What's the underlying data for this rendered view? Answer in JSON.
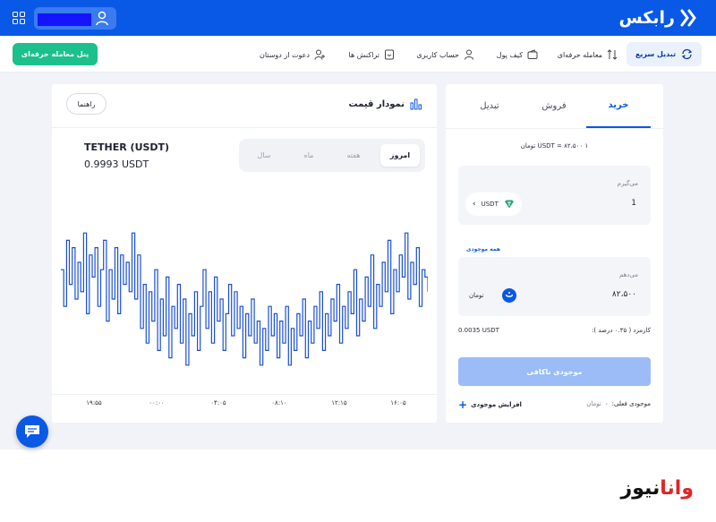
{
  "header": {
    "logo_text": "رابکس",
    "brand_color": "#0a58e6"
  },
  "nav": {
    "quick_swap": "تبدیل سریع",
    "pro_trade": "معامله حرفه‌ای",
    "wallet": "کیف پول",
    "account": "حساب کاربری",
    "transactions": "تراکنش ها",
    "invite": "دعوت از دوستان",
    "pro_panel_button": "پنل معامله حرفه‌ای"
  },
  "chart_panel": {
    "title": "نمودار قیمت",
    "guide_button": "راهنما",
    "coin_name": "TETHER (USDT)",
    "coin_price": "0.9993 USDT",
    "periods": [
      "امروز",
      "هفته",
      "ماه",
      "سال"
    ],
    "active_period": "امروز"
  },
  "chart_data": {
    "type": "line",
    "title": "",
    "xlabel": "",
    "ylabel": "",
    "x_ticks": [
      "۱۹:۵۵",
      "۰۰:۰۰",
      "۰۴:۰۵",
      "۰۸:۱۰",
      "۱۲:۱۵",
      "۱۶:۰۵"
    ],
    "line_color": "#1a4fd8",
    "ylim": [
      0,
      100
    ],
    "values": [
      70,
      45,
      90,
      60,
      85,
      50,
      75,
      55,
      95,
      40,
      80,
      65,
      85,
      45,
      70,
      90,
      35,
      70,
      50,
      85,
      40,
      80,
      60,
      75,
      55,
      95,
      50,
      80,
      30,
      60,
      20,
      55,
      35,
      70,
      15,
      50,
      25,
      65,
      10,
      45,
      30,
      60,
      20,
      50,
      5,
      40,
      25,
      55,
      15,
      45,
      70,
      30,
      55,
      20,
      65,
      35,
      50,
      15,
      40,
      60,
      25,
      55,
      30,
      45,
      10,
      40,
      25,
      50,
      20,
      35,
      5,
      30,
      15,
      45,
      25,
      40,
      10,
      35,
      20,
      45,
      5,
      30,
      15,
      40,
      25,
      50,
      10,
      35,
      20,
      45,
      30,
      55,
      15,
      40,
      25,
      50,
      35,
      60,
      20,
      45,
      30,
      55,
      40,
      70,
      25,
      50,
      35,
      65,
      45,
      80,
      30,
      60,
      45,
      75,
      55,
      90,
      40,
      70,
      55,
      80,
      65,
      95,
      50,
      75,
      60,
      85,
      45,
      70,
      65,
      55
    ]
  },
  "trade_panel": {
    "tabs": [
      "خرید",
      "فروش",
      "تبدیل"
    ],
    "active_tab": "خرید",
    "rate": "۱ USDT = ۸۲،۵۰۰ تومان",
    "receive_label": "می‌گیرم",
    "receive_value": "1",
    "receive_currency": "USDT",
    "all_balance": "همه موجودی",
    "pay_label": "می‌دهم",
    "pay_value": "۸۲،۵۰۰",
    "pay_currency": "تومان",
    "fee_label": "کارمزد ( ۰.۳۵ درصد ):",
    "fee_value": "0.0035 USDT",
    "submit_button": "موجودی ناکافی",
    "balance_label": "موجودی فعلی:",
    "balance_value": "۰",
    "balance_unit": "تومان",
    "add_balance": "افزایش موجودی"
  },
  "watermark": {
    "part_a": "وانا",
    "part_b": "نیوز"
  }
}
